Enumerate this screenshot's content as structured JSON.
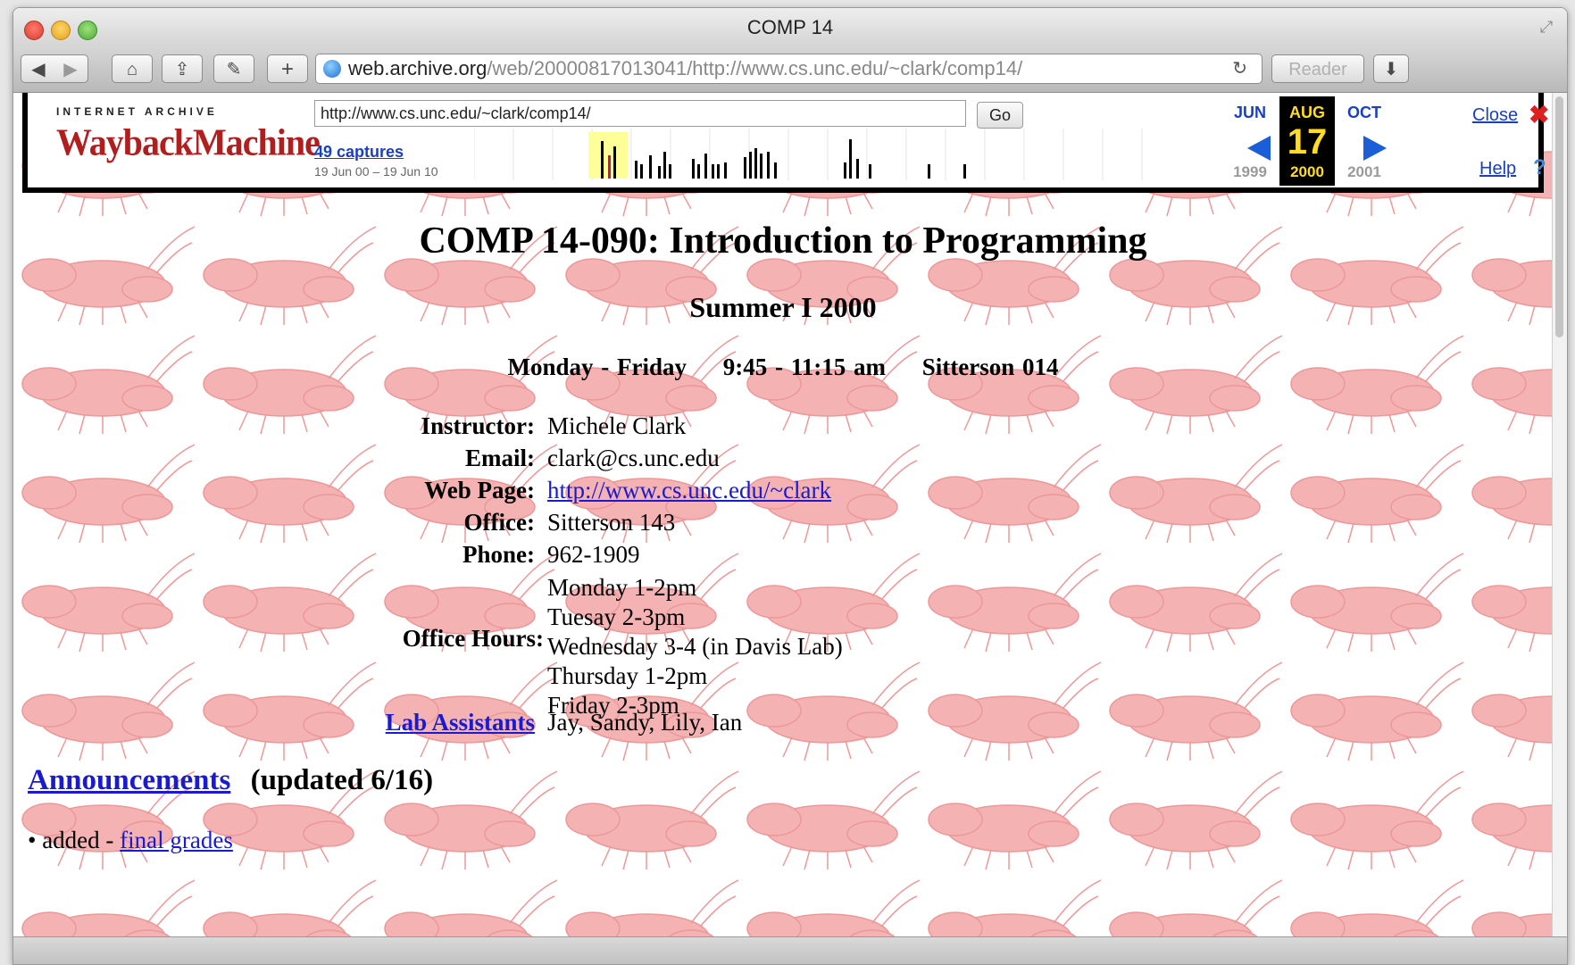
{
  "window": {
    "title": "COMP 14"
  },
  "toolbar": {
    "back_icon": "back-arrow",
    "forward_icon": "forward-arrow",
    "url_host": "web.archive.org",
    "url_rest": "/web/20000817013041/http://www.cs.unc.edu/~clark/comp14/",
    "reader_label": "Reader"
  },
  "wayback": {
    "logo_top": "INTERNET ARCHIVE",
    "logo_main": "WaybackMachine",
    "url_value": "http://www.cs.unc.edu/~clark/comp14/",
    "go_label": "Go",
    "captures_link": "49 captures",
    "captures_range": "19 Jun 00 – 19 Jun 10",
    "months": [
      {
        "label": "JUN",
        "day": "",
        "year": "1999"
      },
      {
        "label": "AUG",
        "day": "17",
        "year": "2000"
      },
      {
        "label": "OCT",
        "day": "",
        "year": "2001"
      }
    ],
    "close_label": "Close",
    "help_label": "Help"
  },
  "page": {
    "title": "COMP 14-090: Introduction to Programming",
    "subtitle": "Summer I 2000",
    "schedule": {
      "days": "Monday - Friday",
      "time": "9:45 - 11:15 am",
      "room": "Sitterson 014"
    },
    "info": [
      {
        "label": "Instructor:",
        "value": "Michele Clark"
      },
      {
        "label": "Email:",
        "value": "clark@cs.unc.edu"
      },
      {
        "label": "Web Page:",
        "value": "http://www.cs.unc.edu/~clark"
      },
      {
        "label": "Office:",
        "value": "Sitterson 143"
      },
      {
        "label": "Phone:",
        "value": "962-1909"
      }
    ],
    "office_hours_label": "Office Hours:",
    "office_hours": [
      "Monday 1-2pm",
      "Tuesay 2-3pm",
      "Wednesday 3-4 (in Davis Lab)",
      "Thursday 1-2pm",
      "Friday 2-3pm"
    ],
    "lab_assistants_label": "Lab Assistants",
    "lab_assistants_value": "Jay, Sandy, Lily, Ian",
    "announcements_label": "Announcements",
    "announcements_updated": "(updated 6/16)",
    "announcement_item_prefix": "added -",
    "announcement_item_link": "final grades"
  }
}
